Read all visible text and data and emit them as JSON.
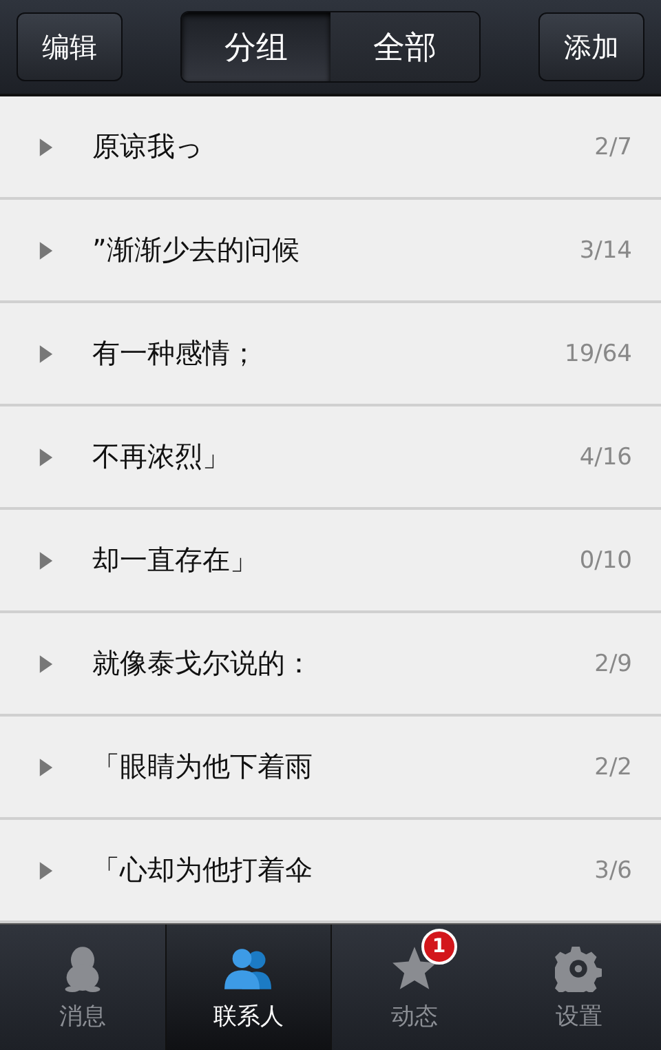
{
  "header": {
    "left_button": "编辑",
    "right_button": "添加",
    "segments": [
      {
        "label": "分组",
        "selected": true
      },
      {
        "label": "全部",
        "selected": false
      }
    ]
  },
  "groups": [
    {
      "name": "原谅我っ",
      "count": "2/7",
      "expanded": false
    },
    {
      "name": "”渐渐少去的问候",
      "count": "3/14",
      "expanded": false
    },
    {
      "name": "有一种感情；",
      "count": "19/64",
      "expanded": false
    },
    {
      "name": "不再浓烈」",
      "count": "4/16",
      "expanded": false
    },
    {
      "name": "却一直存在」",
      "count": "0/10",
      "expanded": false
    },
    {
      "name": "就像泰戈尔说的：",
      "count": "2/9",
      "expanded": false
    },
    {
      "name": "「眼睛为他下着雨",
      "count": "2/2",
      "expanded": false
    },
    {
      "name": "「心却为他打着伞",
      "count": "3/6",
      "expanded": false
    }
  ],
  "tab_bar": [
    {
      "label": "消息",
      "kind": "penguin",
      "selected": false
    },
    {
      "label": "联系人",
      "kind": "contacts",
      "selected": true
    },
    {
      "label": "动态",
      "kind": "star",
      "selected": false,
      "badge": "1"
    },
    {
      "label": "设置",
      "kind": "gear",
      "selected": false
    }
  ]
}
